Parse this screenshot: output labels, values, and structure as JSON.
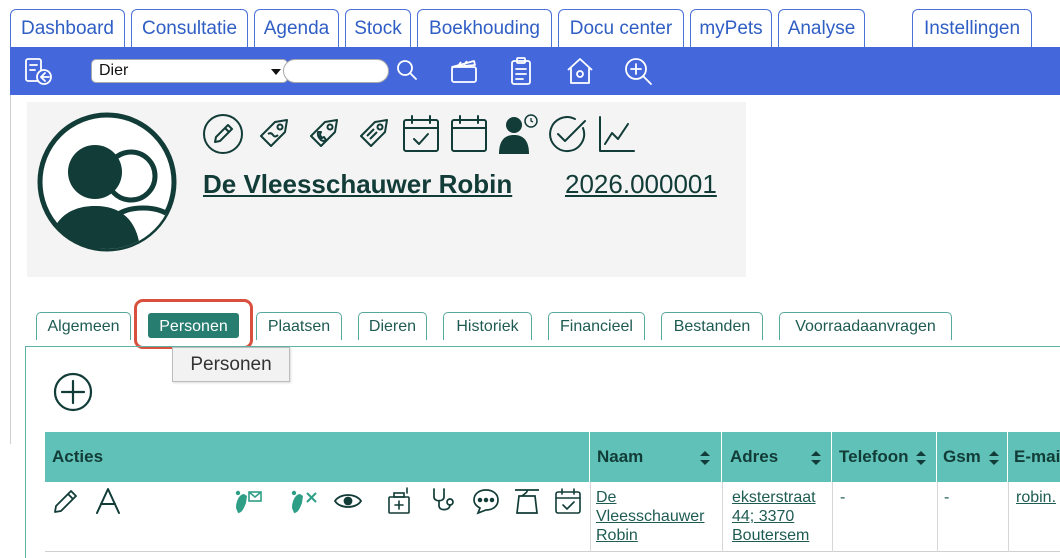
{
  "nav": {
    "tabs": [
      "Dashboard",
      "Consultatie",
      "Agenda",
      "Stock",
      "Boekhouding",
      "Docu center",
      "myPets",
      "Analyse"
    ],
    "settings": "Instellingen"
  },
  "toolbar": {
    "select_value": "Dier",
    "search_value": "",
    "icons": [
      "back-list-icon",
      "search-icon",
      "clapperboard-icon",
      "clipboard-icon",
      "home-icon",
      "zoom-in-icon"
    ]
  },
  "patient": {
    "name": "De Vleesschauwer Robin",
    "id": "2026.000001",
    "icons": [
      "edit-icon",
      "tag-icon",
      "phone-tag-icon",
      "price-tag-icon",
      "calendar-check-icon",
      "calendar-icon",
      "person-clock-icon",
      "check-circle-icon",
      "line-chart-icon"
    ]
  },
  "subtabs": [
    "Algemeen",
    "Personen",
    "Plaatsen",
    "Dieren",
    "Historiek",
    "Financieel",
    "Bestanden",
    "Voorraadaanvragen"
  ],
  "active_subtab": "Personen",
  "tooltip": "Personen",
  "table": {
    "headers": [
      "Acties",
      "Naam",
      "Adres",
      "Telefoon",
      "Gsm",
      "E-mai"
    ],
    "row": {
      "name_lines": [
        "De",
        "Vleesschauwer",
        "Robin"
      ],
      "address_lines": [
        "eksterstraat",
        "44; 3370",
        "Boutersem"
      ],
      "telefoon": "-",
      "gsm": "-",
      "email": "robin."
    }
  },
  "colors": {
    "nav_blue": "#4468dc",
    "teal_dark": "#123c37",
    "teal_active": "#267d70",
    "table_head": "#5fc1b7",
    "focus_red": "#d9503f"
  }
}
